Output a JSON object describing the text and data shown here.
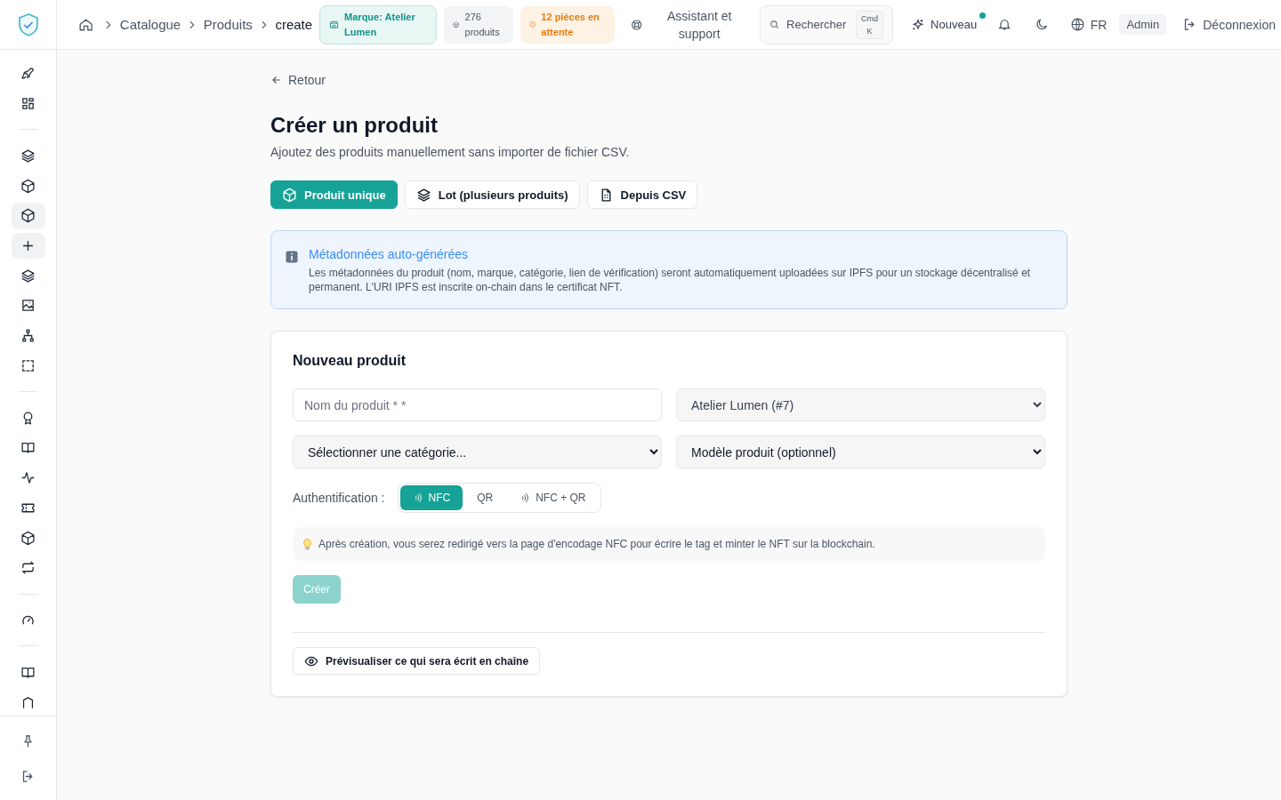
{
  "sidebar": {
    "sections": [
      {
        "items": [
          {
            "selected": false
          },
          {
            "selected": false
          }
        ]
      },
      {
        "items": [
          {
            "selected": false
          },
          {
            "selected": false
          },
          {
            "selected": true
          },
          {
            "selected": true
          },
          {
            "selected": false
          },
          {
            "selected": false
          },
          {
            "selected": false
          },
          {
            "selected": false
          }
        ]
      },
      {
        "items": [
          {
            "selected": false
          },
          {
            "selected": false
          },
          {
            "selected": false
          },
          {
            "selected": false
          },
          {
            "selected": false
          },
          {
            "selected": false
          }
        ]
      },
      {
        "items": [
          {
            "selected": false
          }
        ]
      },
      {
        "items": [
          {
            "selected": false
          },
          {
            "selected": false
          }
        ]
      }
    ],
    "bottom": [
      {
        "selected": false
      },
      {
        "selected": false
      }
    ]
  },
  "breadcrumbs": [
    {
      "label": "Catalogue",
      "current": false
    },
    {
      "label": "Produits",
      "current": false
    },
    {
      "label": "create",
      "current": true
    }
  ],
  "badges": [
    {
      "kind": "brand",
      "label": "Marque: Atelier Lumen"
    },
    {
      "kind": "count",
      "label": "276 produits"
    },
    {
      "kind": "pending",
      "label": "12 pièces en attente"
    }
  ],
  "header": {
    "assistant": "Assistant et support",
    "search": {
      "placeholder": "Rechercher",
      "shortcut_1": "Cmd",
      "shortcut_2": "K"
    },
    "new": {
      "label": "Nouveau",
      "dot": true
    },
    "language": "FR",
    "role": "Admin",
    "logout": "Déconnexion"
  },
  "back": "Retour",
  "title": "Créer un produit",
  "subtitle": "Ajoutez des produits manuellement sans importer de fichier CSV.",
  "modes": [
    {
      "label": "Produit unique",
      "selected": true
    },
    {
      "label": "Lot (plusieurs produits)",
      "selected": false
    },
    {
      "label": "Depuis CSV",
      "selected": false
    }
  ],
  "info": {
    "title": "Métadonnées auto-générées",
    "text": "Les métadonnées du produit (nom, marque, catégorie, lien de vérification) seront automatiquement uploadées sur IPFS pour un stockage décentralisé et permanent. L'URI IPFS est inscrite on-chain dans le certificat NFT."
  },
  "form": {
    "title": "Nouveau produit",
    "fields": [
      {
        "kind": "input",
        "placeholder": "Nom du produit * *"
      },
      {
        "kind": "select",
        "value": "Atelier Lumen (#7)",
        "disabled": true
      },
      {
        "kind": "select",
        "value": "Sélectionner une catégorie...",
        "disabled": false
      },
      {
        "kind": "select",
        "value": "Modèle produit (optionnel)",
        "disabled": false
      }
    ],
    "auth_label": "Authentification :",
    "auth_options": [
      {
        "label": "NFC",
        "kind": "nfc",
        "selected": true
      },
      {
        "label": "QR",
        "kind": "plain",
        "selected": false
      },
      {
        "label": "NFC + QR",
        "kind": "nfc",
        "selected": false
      }
    ],
    "hint": "Après création, vous serez redirigé vers la page d'encodage NFC pour écrire le tag et minter le NFT sur la blockchain.",
    "submit": {
      "label": "Créer",
      "disabled": true
    },
    "preview": "Prévisualiser ce qui sera écrit en chaîne"
  }
}
